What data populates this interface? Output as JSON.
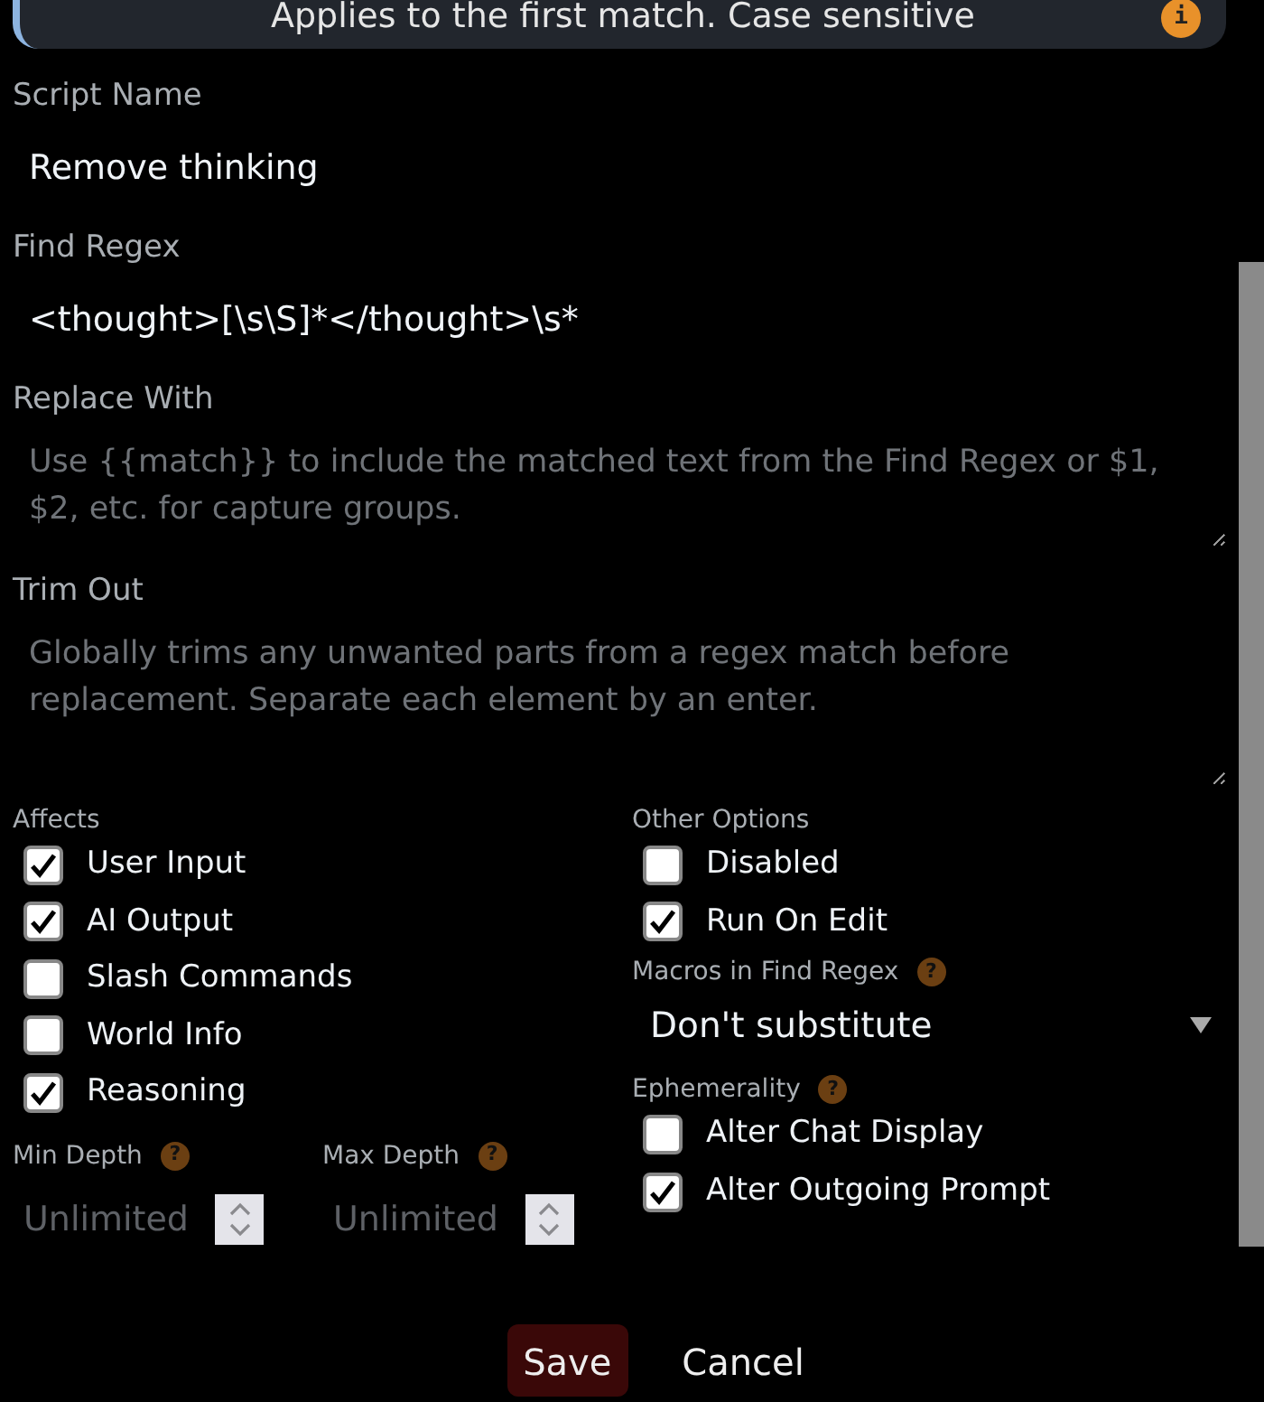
{
  "banner": {
    "text": "Applies to the first match. Case sensitive",
    "icon": "i"
  },
  "fields": [
    {
      "label": "Script Name",
      "kind": "input",
      "value": "Remove thinking"
    },
    {
      "label": "Find Regex",
      "kind": "input",
      "value": "<thought>[\\s\\S]*</thought>\\s*"
    },
    {
      "label": "Replace With",
      "kind": "textarea",
      "placeholder": "Use {{match}} to include the matched text from the Find Regex or $1, $2, etc. for capture groups."
    },
    {
      "label": "Trim Out",
      "kind": "textarea",
      "placeholder": "Globally trims any unwanted parts from a regex match before replacement. Separate each element by an enter."
    }
  ],
  "affects": {
    "label": "Affects",
    "options": [
      {
        "label": "User Input",
        "checked": true
      },
      {
        "label": "AI Output",
        "checked": true
      },
      {
        "label": "Slash Commands",
        "checked": false
      },
      {
        "label": "World Info",
        "checked": false
      },
      {
        "label": "Reasoning",
        "checked": true
      }
    ]
  },
  "depth": [
    {
      "label": "Min Depth",
      "hint": "?",
      "placeholder": "Unlimited"
    },
    {
      "label": "Max Depth",
      "hint": "?",
      "placeholder": "Unlimited"
    }
  ],
  "other_options": {
    "label": "Other Options",
    "options": [
      {
        "label": "Disabled",
        "checked": false
      },
      {
        "label": "Run On Edit",
        "checked": true
      }
    ]
  },
  "macros": {
    "label": "Macros in Find Regex",
    "hint": "?",
    "value": "Don't substitute"
  },
  "ephemerality": {
    "label": "Ephemerality",
    "hint": "?",
    "options": [
      {
        "label": "Alter Chat Display",
        "checked": false
      },
      {
        "label": "Alter Outgoing Prompt",
        "checked": true
      }
    ]
  },
  "buttons": [
    {
      "label": "Save",
      "kind": "primary"
    },
    {
      "label": "Cancel",
      "kind": "plain"
    }
  ]
}
